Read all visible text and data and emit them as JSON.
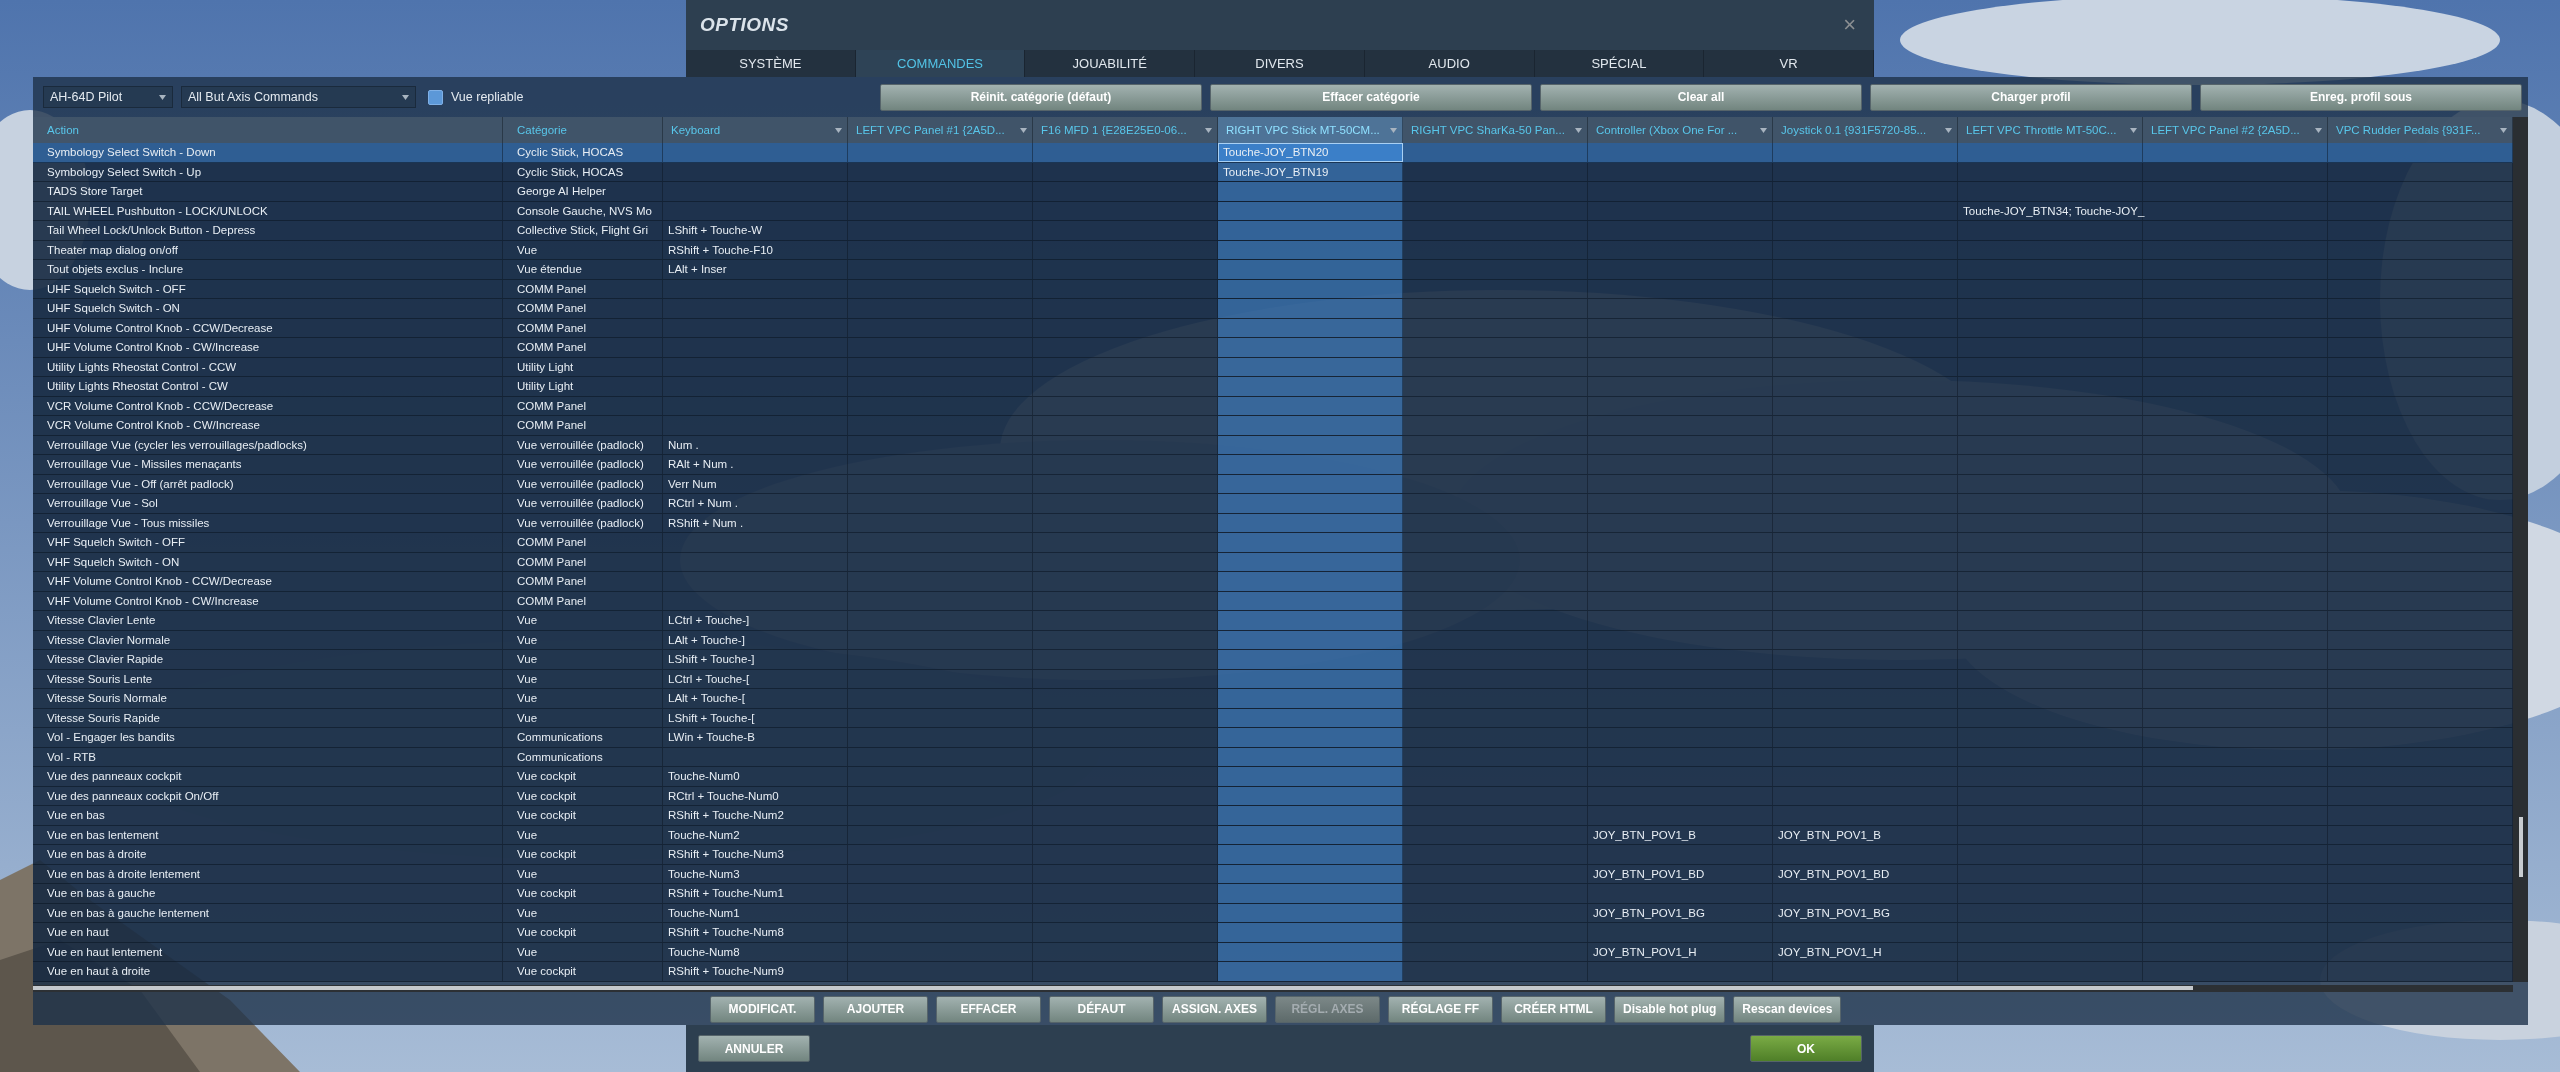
{
  "window": {
    "title": "OPTIONS",
    "close": "×"
  },
  "tabs": [
    {
      "label": "SYSTÈME",
      "selected": false
    },
    {
      "label": "COMMANDES",
      "selected": true
    },
    {
      "label": "JOUABILITÉ",
      "selected": false
    },
    {
      "label": "DIVERS",
      "selected": false
    },
    {
      "label": "AUDIO",
      "selected": false
    },
    {
      "label": "SPÉCIAL",
      "selected": false
    },
    {
      "label": "VR",
      "selected": false
    }
  ],
  "toolbar": {
    "aircraft": "AH-64D Pilot",
    "filter": "All But Axis Commands",
    "collapsible_view": {
      "label": "Vue repliable",
      "checked": true
    },
    "buttons": [
      "Réinit. catégorie (défaut)",
      "Effacer catégorie",
      "Clear all",
      "Charger profil",
      "Enreg. profil sous"
    ]
  },
  "table": {
    "columns": [
      {
        "label": "Action",
        "kind": "text",
        "selected": false
      },
      {
        "label": "Catégorie",
        "kind": "text",
        "selected": false
      },
      {
        "label": "Keyboard",
        "kind": "binding",
        "selected": false
      },
      {
        "label": "LEFT VPC Panel #1 {2A5D...",
        "kind": "binding",
        "selected": false
      },
      {
        "label": "F16 MFD 1 {E28E25E0-06...",
        "kind": "binding",
        "selected": false
      },
      {
        "label": "RIGHT VPC Stick MT-50CM...",
        "kind": "binding",
        "selected": true
      },
      {
        "label": "RIGHT VPC SharKa-50 Pan...",
        "kind": "binding",
        "selected": false
      },
      {
        "label": "Controller (Xbox One For ...",
        "kind": "binding",
        "selected": false
      },
      {
        "label": "Joystick 0.1 {931F5720-85...",
        "kind": "binding",
        "selected": false
      },
      {
        "label": "LEFT VPC Throttle MT-50C...",
        "kind": "binding",
        "selected": false
      },
      {
        "label": "LEFT VPC Panel #2 {2A5D...",
        "kind": "binding",
        "selected": false
      },
      {
        "label": "VPC Rudder Pedals {931F...",
        "kind": "binding",
        "selected": false
      }
    ],
    "rows": [
      {
        "action": "Symbology Select Switch - Down",
        "category": "Cyclic Stick, HOCAS",
        "right_stick": "Touche-JOY_BTN20",
        "selected": true
      },
      {
        "action": "Symbology Select Switch - Up",
        "category": "Cyclic Stick, HOCAS",
        "right_stick": "Touche-JOY_BTN19",
        "selected": false
      },
      {
        "action": "TADS Store Target",
        "category": "George AI Helper",
        "selected": false
      },
      {
        "action": "TAIL WHEEL Pushbutton - LOCK/UNLOCK",
        "category": "Console Gauche, NVS Mo",
        "left_throttle": "Touche-JOY_BTN34; Touche-JOY_",
        "selected": false
      },
      {
        "action": "Tail Wheel Lock/Unlock Button - Depress",
        "category": "Collective Stick, Flight Gri",
        "keyboard": "LShift + Touche-W",
        "selected": false
      },
      {
        "action": "Theater map dialog on/off",
        "category": "Vue",
        "keyboard": "RShift + Touche-F10",
        "selected": false
      },
      {
        "action": "Tout objets exclus - Inclure",
        "category": "Vue étendue",
        "keyboard": "LAlt + Inser",
        "selected": false
      },
      {
        "action": "UHF Squelch Switch - OFF",
        "category": "COMM Panel",
        "selected": false
      },
      {
        "action": "UHF Squelch Switch - ON",
        "category": "COMM Panel",
        "selected": false
      },
      {
        "action": "UHF Volume Control Knob - CCW/Decrease",
        "category": "COMM Panel",
        "selected": false
      },
      {
        "action": "UHF Volume Control Knob - CW/Increase",
        "category": "COMM Panel",
        "selected": false
      },
      {
        "action": "Utility Lights Rheostat Control - CCW",
        "category": "Utility Light",
        "selected": false
      },
      {
        "action": "Utility Lights Rheostat Control - CW",
        "category": "Utility Light",
        "selected": false
      },
      {
        "action": "VCR Volume Control Knob - CCW/Decrease",
        "category": "COMM Panel",
        "selected": false
      },
      {
        "action": "VCR Volume Control Knob - CW/Increase",
        "category": "COMM Panel",
        "selected": false
      },
      {
        "action": "Verrouillage Vue (cycler les verrouillages/padlocks)",
        "category": "Vue verrouillée (padlock)",
        "keyboard": "Num .",
        "selected": false
      },
      {
        "action": "Verrouillage Vue - Missiles menaçants",
        "category": "Vue verrouillée (padlock)",
        "keyboard": "RAlt + Num .",
        "selected": false
      },
      {
        "action": "Verrouillage Vue - Off (arrêt padlock)",
        "category": "Vue verrouillée (padlock)",
        "keyboard": "Verr Num",
        "selected": false
      },
      {
        "action": "Verrouillage Vue - Sol",
        "category": "Vue verrouillée (padlock)",
        "keyboard": "RCtrl + Num .",
        "selected": false
      },
      {
        "action": "Verrouillage Vue - Tous missiles",
        "category": "Vue verrouillée (padlock)",
        "keyboard": "RShift + Num .",
        "selected": false
      },
      {
        "action": "VHF Squelch Switch - OFF",
        "category": "COMM Panel",
        "selected": false
      },
      {
        "action": "VHF Squelch Switch - ON",
        "category": "COMM Panel",
        "selected": false
      },
      {
        "action": "VHF Volume Control Knob - CCW/Decrease",
        "category": "COMM Panel",
        "selected": false
      },
      {
        "action": "VHF Volume Control Knob - CW/Increase",
        "category": "COMM Panel",
        "selected": false
      },
      {
        "action": "Vitesse Clavier Lente",
        "category": "Vue",
        "keyboard": "LCtrl + Touche-]",
        "selected": false
      },
      {
        "action": "Vitesse Clavier Normale",
        "category": "Vue",
        "keyboard": "LAlt + Touche-]",
        "selected": false
      },
      {
        "action": "Vitesse Clavier Rapide",
        "category": "Vue",
        "keyboard": "LShift + Touche-]",
        "selected": false
      },
      {
        "action": "Vitesse Souris Lente",
        "category": "Vue",
        "keyboard": "LCtrl + Touche-[",
        "selected": false
      },
      {
        "action": "Vitesse Souris Normale",
        "category": "Vue",
        "keyboard": "LAlt + Touche-[",
        "selected": false
      },
      {
        "action": "Vitesse Souris Rapide",
        "category": "Vue",
        "keyboard": "LShift + Touche-[",
        "selected": false
      },
      {
        "action": "Vol - Engager les bandits",
        "category": "Communications",
        "keyboard": "LWin + Touche-B",
        "selected": false
      },
      {
        "action": "Vol - RTB",
        "category": "Communications",
        "selected": false
      },
      {
        "action": "Vue des panneaux cockpit",
        "category": "Vue cockpit",
        "keyboard": "Touche-Num0",
        "selected": false
      },
      {
        "action": "Vue des panneaux cockpit On/Off",
        "category": "Vue cockpit",
        "keyboard": "RCtrl + Touche-Num0",
        "selected": false
      },
      {
        "action": "Vue en bas",
        "category": "Vue cockpit",
        "keyboard": "RShift + Touche-Num2",
        "selected": false
      },
      {
        "action": "Vue en bas lentement",
        "category": "Vue",
        "keyboard": "Touche-Num2",
        "controller": "JOY_BTN_POV1_B",
        "joystick": "JOY_BTN_POV1_B",
        "selected": false
      },
      {
        "action": "Vue en bas à droite",
        "category": "Vue cockpit",
        "keyboard": "RShift + Touche-Num3",
        "selected": false
      },
      {
        "action": "Vue en bas à droite lentement",
        "category": "Vue",
        "keyboard": "Touche-Num3",
        "controller": "JOY_BTN_POV1_BD",
        "joystick": "JOY_BTN_POV1_BD",
        "selected": false
      },
      {
        "action": "Vue en bas à gauche",
        "category": "Vue cockpit",
        "keyboard": "RShift + Touche-Num1",
        "selected": false
      },
      {
        "action": "Vue en bas à gauche lentement",
        "category": "Vue",
        "keyboard": "Touche-Num1",
        "controller": "JOY_BTN_POV1_BG",
        "joystick": "JOY_BTN_POV1_BG",
        "selected": false
      },
      {
        "action": "Vue en haut",
        "category": "Vue cockpit",
        "keyboard": "RShift + Touche-Num8",
        "selected": false
      },
      {
        "action": "Vue en haut lentement",
        "category": "Vue",
        "keyboard": "Touche-Num8",
        "controller": "JOY_BTN_POV1_H",
        "joystick": "JOY_BTN_POV1_H",
        "selected": false
      },
      {
        "action": "Vue en haut à droite",
        "category": "Vue cockpit",
        "keyboard": "RShift + Touche-Num9",
        "selected": false
      }
    ]
  },
  "actions": [
    {
      "label": "MODIFICAT.",
      "disabled": false
    },
    {
      "label": "AJOUTER",
      "disabled": false
    },
    {
      "label": "EFFACER",
      "disabled": false
    },
    {
      "label": "DÉFAUT",
      "disabled": false
    },
    {
      "label": "ASSIGN. AXES",
      "disabled": false
    },
    {
      "label": "RÉGL. AXES",
      "disabled": true
    },
    {
      "label": "RÉGLAGE FF",
      "disabled": false
    },
    {
      "label": "CRÉER HTML",
      "disabled": false
    },
    {
      "label": "Disable hot plug",
      "disabled": false
    },
    {
      "label": "Rescan devices",
      "disabled": false
    }
  ],
  "footer": [
    {
      "label": "ANNULER",
      "kind": "secondary"
    },
    {
      "label": "OK",
      "kind": "primary"
    }
  ]
}
